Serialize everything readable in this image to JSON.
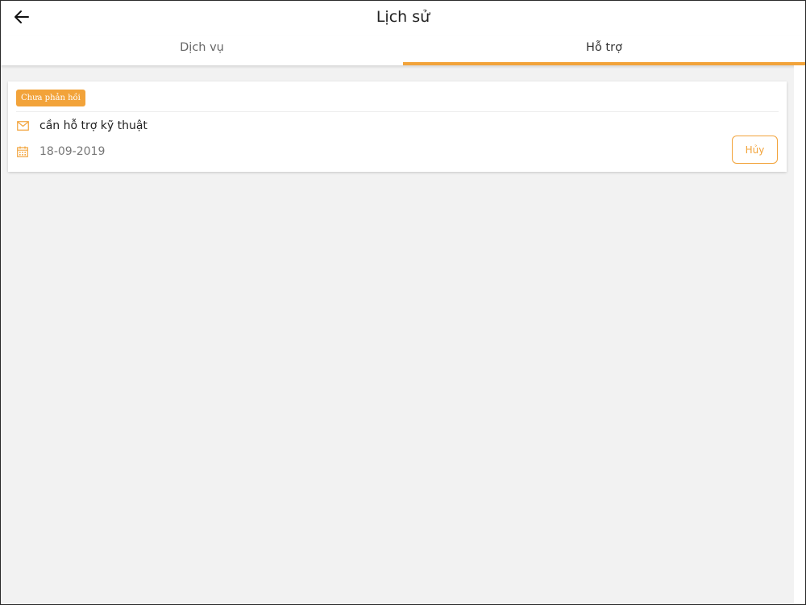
{
  "header": {
    "title": "Lịch sử",
    "back_icon": "arrow-left-icon"
  },
  "tabs": [
    {
      "label": "Dịch vụ",
      "active": false
    },
    {
      "label": "Hỗ trợ",
      "active": true
    }
  ],
  "ticket": {
    "status": "Chưa phản hồi",
    "message": "cần hỗ trợ kỹ thuật",
    "date": "18-09-2019",
    "cancel_label": "Hủy",
    "mail_icon": "envelope-icon",
    "date_icon": "calendar-icon"
  },
  "colors": {
    "accent": "#f2a33a",
    "background": "#f2f2f2",
    "card": "#ffffff"
  }
}
